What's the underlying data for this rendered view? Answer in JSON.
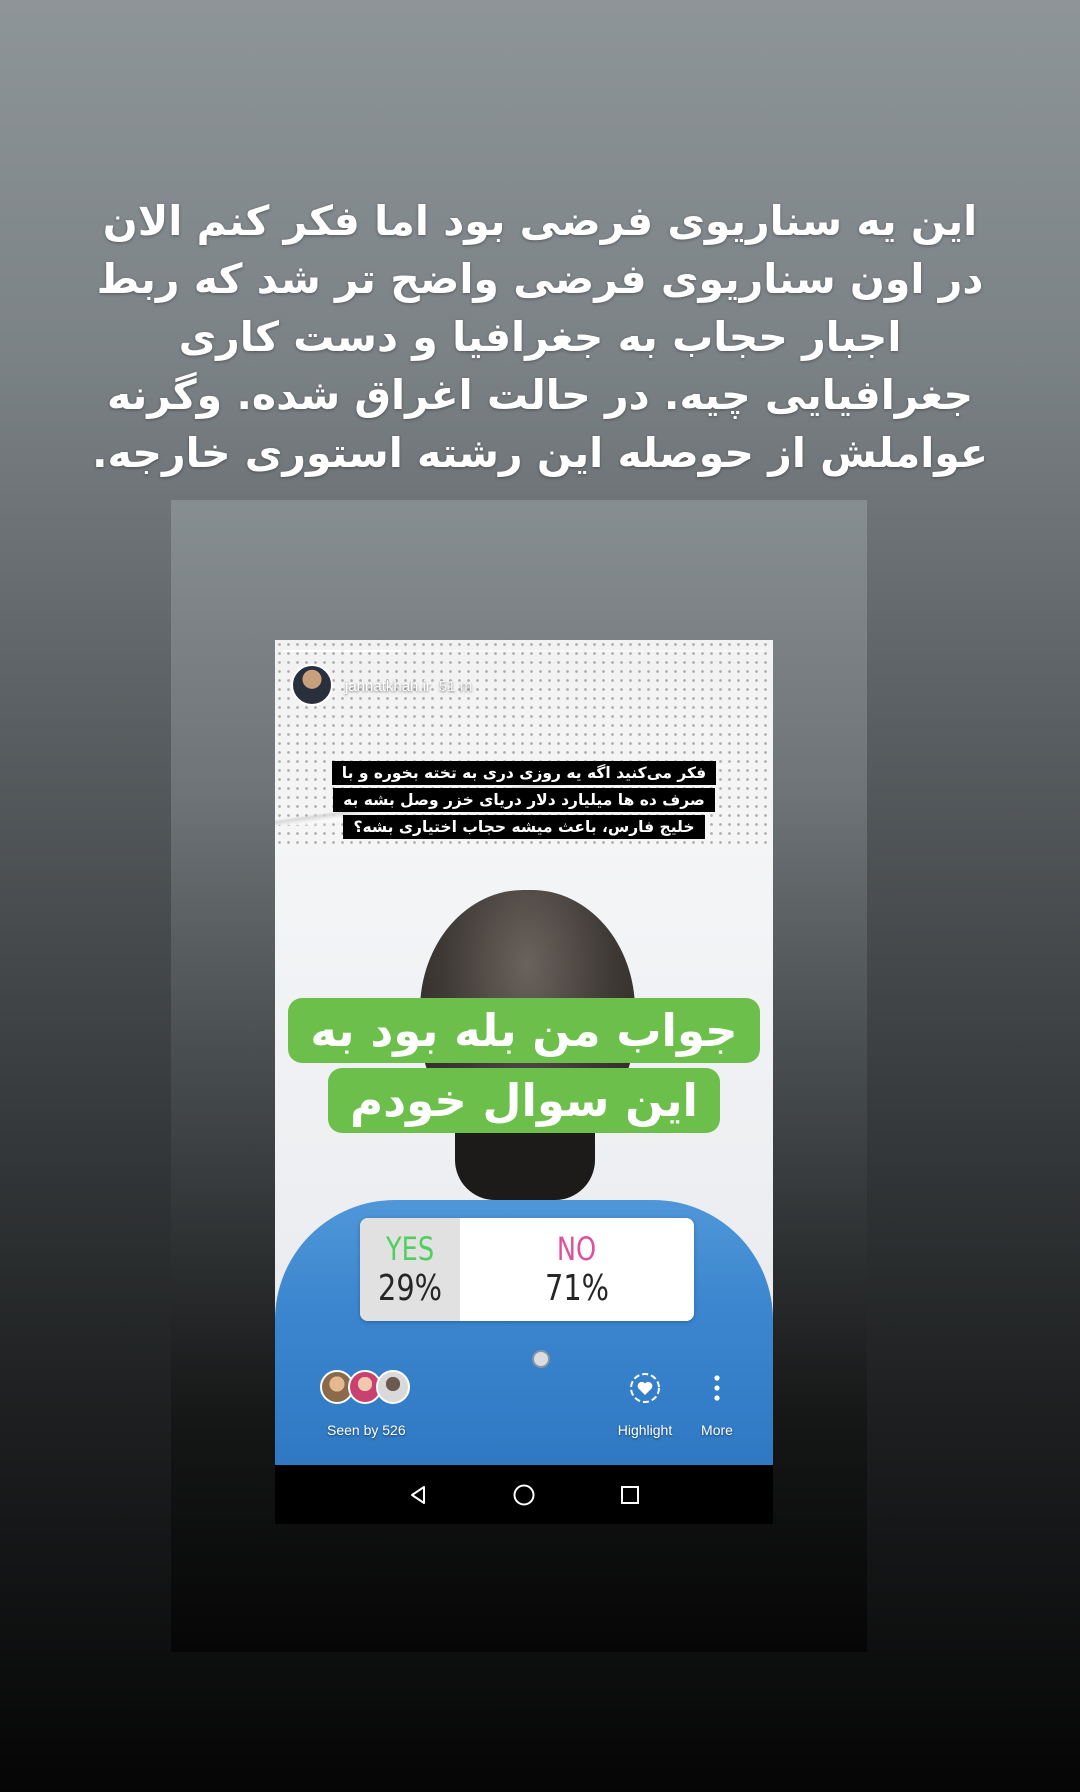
{
  "caption": "این یه سناریوی فرضی بود اما فکر کنم الان در اون سناریوی فرضی واضح تر شد که ربط اجبار حجاب به جغرافیا و دست کاری جغرافیایی چیه. در حالت اغراق شده. وگرنه عواملش از حوصله این رشته استوری خارجه.",
  "story": {
    "username": "jannatkhah.ir",
    "time": "51 m",
    "progress_segments": 8,
    "progress_done": 2,
    "question": "فکر می‌کنید اگه یه روزی دری به تخته بخوره و با صرف ده ها میلیارد دلار دریای خزر وصل بشه به خلیج فارس، باعث میشه حجاب اختیاری بشه؟",
    "answer": "جواب من بله بود به این سوال خودم",
    "poll": {
      "options": [
        {
          "label": "YES",
          "percent": "29%",
          "color": "#4fcf5c"
        },
        {
          "label": "NO",
          "percent": "71%",
          "color": "#e0509b"
        }
      ]
    },
    "seen_by": "Seen by 526",
    "actions": {
      "highlight": "Highlight",
      "more": "More"
    }
  },
  "icons": [
    "highlight-heart-icon",
    "more-vertical-icon",
    "nav-back-icon",
    "nav-home-icon",
    "nav-recents-icon"
  ]
}
